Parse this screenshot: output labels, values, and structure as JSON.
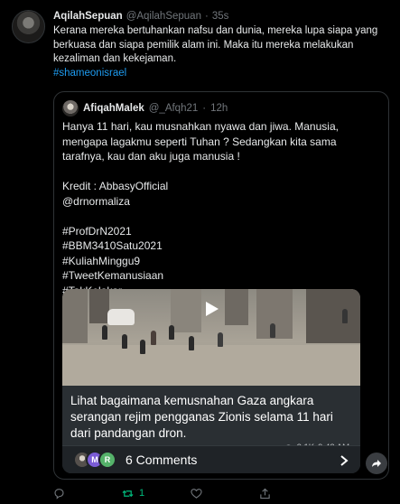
{
  "tweet": {
    "author_name": "AqilahSepuan",
    "author_handle": "@AqilahSepuan",
    "separator": "·",
    "time": "35s",
    "text": "Kerana mereka bertuhankan nafsu dan dunia, mereka lupa siapa yang berkuasa dan siapa pemilik alam ini. Maka itu mereka melakukan kezaliman dan kekejaman.",
    "hashtag": "#shameonisrael"
  },
  "quote": {
    "author_name": "AfiqahMalek",
    "author_handle": "@_Afqh21",
    "separator": "·",
    "time": "12h",
    "lines": [
      "Hanya 11 hari, kau musnahkan nyawa dan jiwa. Manusia, mengapa lagakmu seperti Tuhan ? Sedangkan kita sama tarafnya, kau dan aku juga manusia !",
      "",
      "Kredit : AbbasyOfficial",
      "@drnormaliza",
      "",
      "#ProfDrN2021",
      "#BBM3410Satu2021",
      "#KuliahMinggu9",
      "#TweetKemanusiaan",
      "#TakKelakar"
    ],
    "card": {
      "caption": "Lihat bagaimana kemusnahan Gaza angkara serangan rejim pengganas Zionis selama 11 hari dari pandangan dron.",
      "views": "2.1K",
      "time": "9:43 AM",
      "comment_avatars": [
        "M",
        "R"
      ],
      "comments_label": "6 Comments"
    }
  },
  "actions": {
    "retweet_count": "1"
  },
  "colors": {
    "background": "#000000",
    "text": "#e7e9ea",
    "muted": "#71767b",
    "link": "#1d9bf0",
    "retweet_green": "#00ba7c",
    "border": "#2f3336"
  },
  "icons": {
    "reply": "reply-icon",
    "retweet": "retweet-icon",
    "like": "heart-icon",
    "share": "share-icon",
    "play": "play-icon",
    "eye": "eye-icon",
    "chevron": "chevron-right-icon"
  }
}
